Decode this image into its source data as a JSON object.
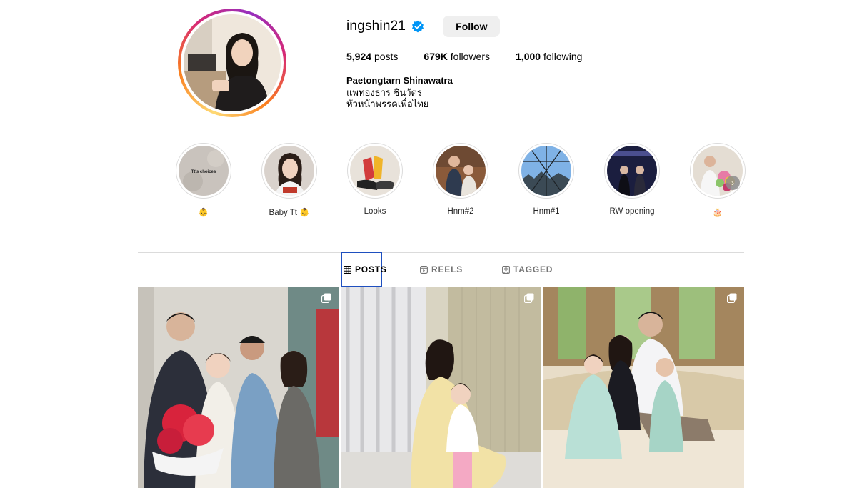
{
  "profile": {
    "username": "ingshin21",
    "follow_label": "Follow",
    "stats": {
      "posts_count": "5,924",
      "posts_label": "posts",
      "followers_count": "679K",
      "followers_label": "followers",
      "following_count": "1,000",
      "following_label": "following"
    },
    "bio": {
      "name": "Paetongtarn Shinawatra",
      "line1": "แพทองธาร ชินวัตร",
      "line2": "หัวหน้าพรรคเพื่อไทย"
    }
  },
  "highlights": [
    {
      "label": "👶",
      "thumb_text": "Tt's choices"
    },
    {
      "label": "Baby Tt 👶"
    },
    {
      "label": "Looks"
    },
    {
      "label": "Hnm#2"
    },
    {
      "label": "Hnm#1"
    },
    {
      "label": "RW opening"
    },
    {
      "label": "🎂"
    }
  ],
  "tabs": [
    {
      "label": "POSTS"
    },
    {
      "label": "REELS"
    },
    {
      "label": "TAGGED"
    }
  ],
  "colors": {
    "follow_bg": "#efefef",
    "verified_blue": "#0095f6",
    "active_tab_border": "#1e4fbf"
  }
}
